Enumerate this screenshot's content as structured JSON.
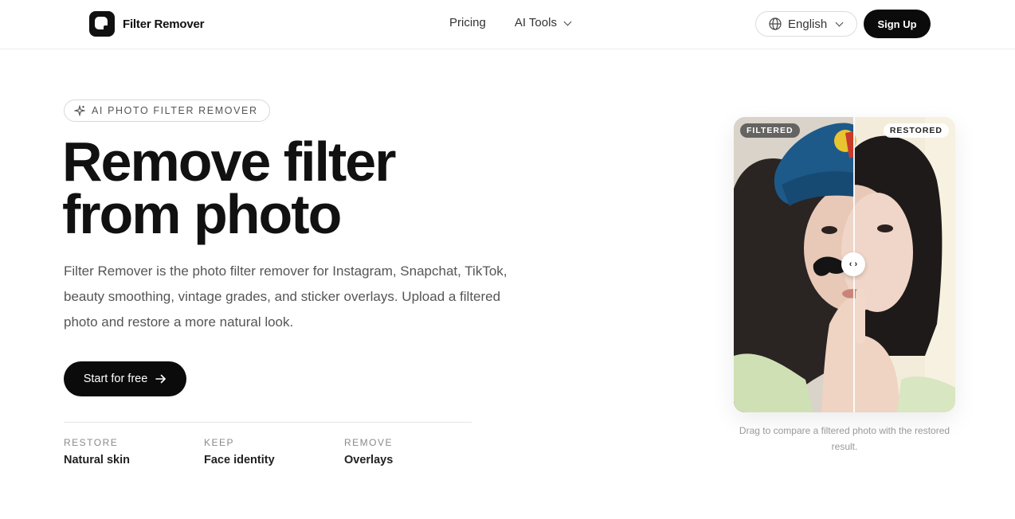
{
  "header": {
    "brand": "Filter Remover",
    "nav": [
      {
        "label": "Pricing"
      },
      {
        "label": "AI Tools"
      }
    ],
    "language": "English",
    "signup_label": "Sign Up"
  },
  "hero": {
    "badge": "AI PHOTO FILTER REMOVER",
    "title_line1": "Remove filter",
    "title_line2": "from photo",
    "description": "Filter Remover is the photo filter remover for Instagram, Snapchat, TikTok, beauty smoothing, vintage grades, and sticker overlays. Upload a filtered photo and restore a more natural look.",
    "cta_label": "Start for free",
    "stats": [
      {
        "label": "RESTORE",
        "value": "Natural skin"
      },
      {
        "label": "KEEP",
        "value": "Face identity"
      },
      {
        "label": "REMOVE",
        "value": "Overlays"
      }
    ]
  },
  "compare": {
    "left_tag": "FILTERED",
    "right_tag": "RESTORED",
    "handle_glyph": "‹ ›",
    "caption": "Drag to compare a filtered photo with the restored result."
  },
  "colors": {
    "primary": "#0b0b0b",
    "text_muted": "#555555",
    "border": "#dcdcdc"
  }
}
